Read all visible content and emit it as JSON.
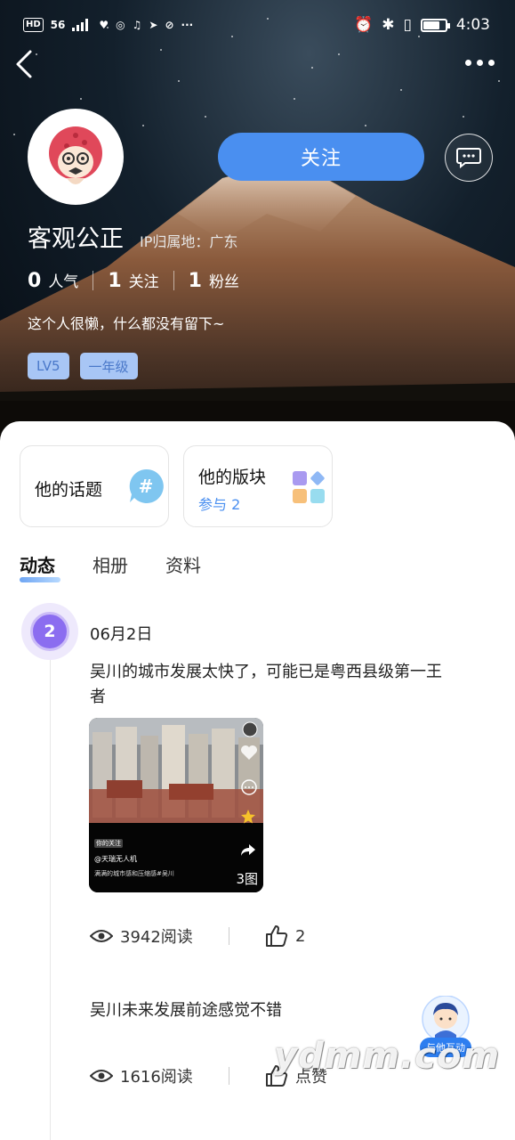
{
  "status_bar": {
    "left_chips": [
      "HD",
      "56"
    ],
    "time": "4:03"
  },
  "profile": {
    "username": "客观公正",
    "ip_location": "IP归属地：广东",
    "follow_label": "关注",
    "stats": [
      {
        "num": "0",
        "label": "人气"
      },
      {
        "num": "1",
        "label": "关注"
      },
      {
        "num": "1",
        "label": "粉丝"
      }
    ],
    "bio": "这个人很懒，什么都没有留下~",
    "badges": [
      "LV5",
      "一年级"
    ]
  },
  "entries": {
    "topics": {
      "title": "他的话题"
    },
    "boards": {
      "title": "他的版块",
      "subtitle": "参与 2"
    }
  },
  "tabs": [
    "动态",
    "相册",
    "资料"
  ],
  "timeline": {
    "marker": "2",
    "date": "06月2日"
  },
  "posts": [
    {
      "text": "吴川的城市发展太快了，可能已是粤西县级第一王者",
      "image": {
        "tag": "你的关注",
        "handle": "@天瑞无人机",
        "caption": "满满的城市感和压缩感#吴川",
        "subcaption": "人·鱼·摄影资源·菜子鱼·才",
        "count": "3图"
      },
      "views": "3942阅读",
      "likes": "2"
    },
    {
      "text": "吴川未来发展前途感觉不错",
      "views": "1616阅读",
      "likes": "点赞"
    }
  ],
  "float_button": {
    "label": "与他互动"
  },
  "watermark": "ydmm.com",
  "colors": {
    "accent": "#4a8ff0",
    "marker": "#8b6df0"
  }
}
